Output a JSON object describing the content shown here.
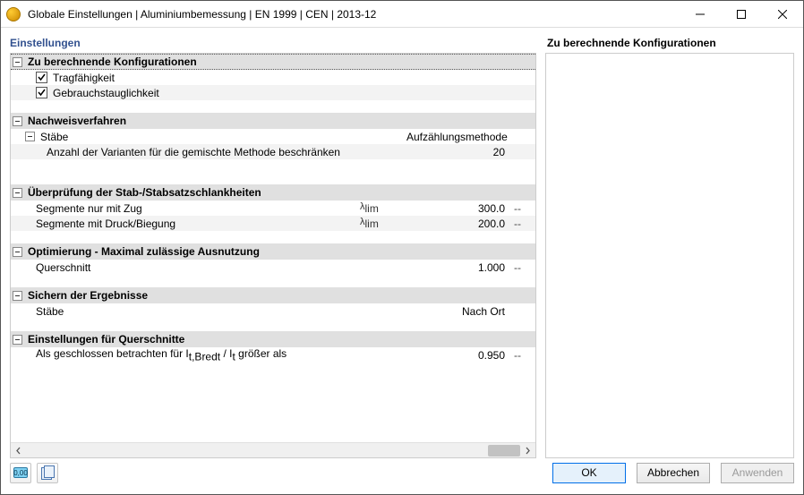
{
  "titlebar": {
    "title": "Globale Einstellungen | Aluminiumbemessung | EN 1999 | CEN | 2013-12"
  },
  "left": {
    "panel_title": "Einstellungen",
    "sections": {
      "s0": {
        "head": "Zu berechnende Konfigurationen",
        "items": [
          {
            "label": "Tragfähigkeit",
            "checked": true
          },
          {
            "label": "Gebrauchstauglichkeit",
            "checked": true
          }
        ]
      },
      "s1": {
        "head": "Nachweisverfahren",
        "sub": {
          "label": "Stäbe",
          "value": "Aufzählungsmethode"
        },
        "child": {
          "label": "Anzahl der Varianten für die gemischte Methode beschränken",
          "value": "20"
        }
      },
      "s2": {
        "head": "Überprüfung der Stab-/Stabsatzschlankheiten",
        "r1": {
          "label": "Segmente nur mit Zug",
          "sym": "λlim",
          "value": "300.0",
          "unit": "--"
        },
        "r2": {
          "label": "Segmente mit Druck/Biegung",
          "sym": "λlim",
          "value": "200.0",
          "unit": "--"
        }
      },
      "s3": {
        "head": "Optimierung - Maximal zulässige Ausnutzung",
        "r1": {
          "label": "Querschnitt",
          "value": "1.000",
          "unit": "--"
        }
      },
      "s4": {
        "head": "Sichern der Ergebnisse",
        "r1": {
          "label": "Stäbe",
          "value": "Nach Ort"
        }
      },
      "s5": {
        "head": "Einstellungen für Querschnitte",
        "r1": {
          "label": "Als geschlossen betrachten für It,Bredt / It größer als",
          "value": "0.950",
          "unit": "--"
        }
      }
    }
  },
  "right": {
    "head": "Zu berechnende Konfigurationen"
  },
  "buttons": {
    "unit_badge": "0,00",
    "ok": "OK",
    "cancel": "Abbrechen",
    "apply": "Anwenden"
  }
}
